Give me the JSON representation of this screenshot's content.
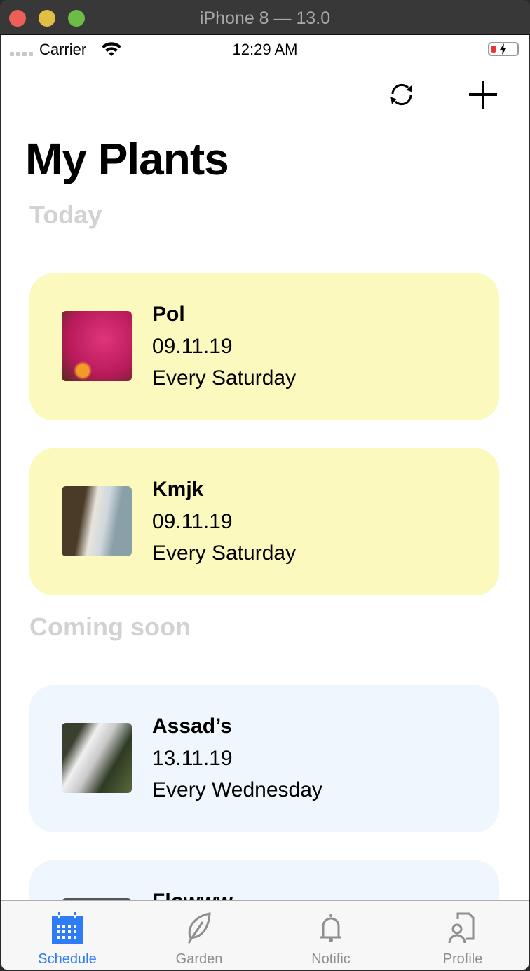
{
  "window": {
    "title": "iPhone 8 — 13.0"
  },
  "status_bar": {
    "carrier": "Carrier",
    "time": "12:29 AM"
  },
  "nav": {
    "refresh_icon": "refresh-icon",
    "add_icon": "plus-icon"
  },
  "title": "My Plants",
  "sections": [
    {
      "title": "Today",
      "color": "#fbf9bd",
      "plants": [
        {
          "name": "Pol",
          "date": "09.11.19",
          "frequency": "Every Saturday"
        },
        {
          "name": "Kmjk",
          "date": "09.11.19",
          "frequency": "Every Saturday"
        }
      ]
    },
    {
      "title": "Coming soon",
      "color": "#eff6fd",
      "plants": [
        {
          "name": "Assad’s",
          "date": "13.11.19",
          "frequency": "Every Wednesday"
        },
        {
          "name": "Flowww"
        }
      ]
    }
  ],
  "tabs": [
    {
      "label": "Schedule",
      "icon": "calendar-icon",
      "active": true
    },
    {
      "label": "Garden",
      "icon": "leaf-icon"
    },
    {
      "label": "Notific",
      "icon": "bell-icon"
    },
    {
      "label": "Profile",
      "icon": "profile-icon"
    }
  ],
  "colors": {
    "accent": "#2f7df6",
    "inactive": "#8e8e8e"
  }
}
